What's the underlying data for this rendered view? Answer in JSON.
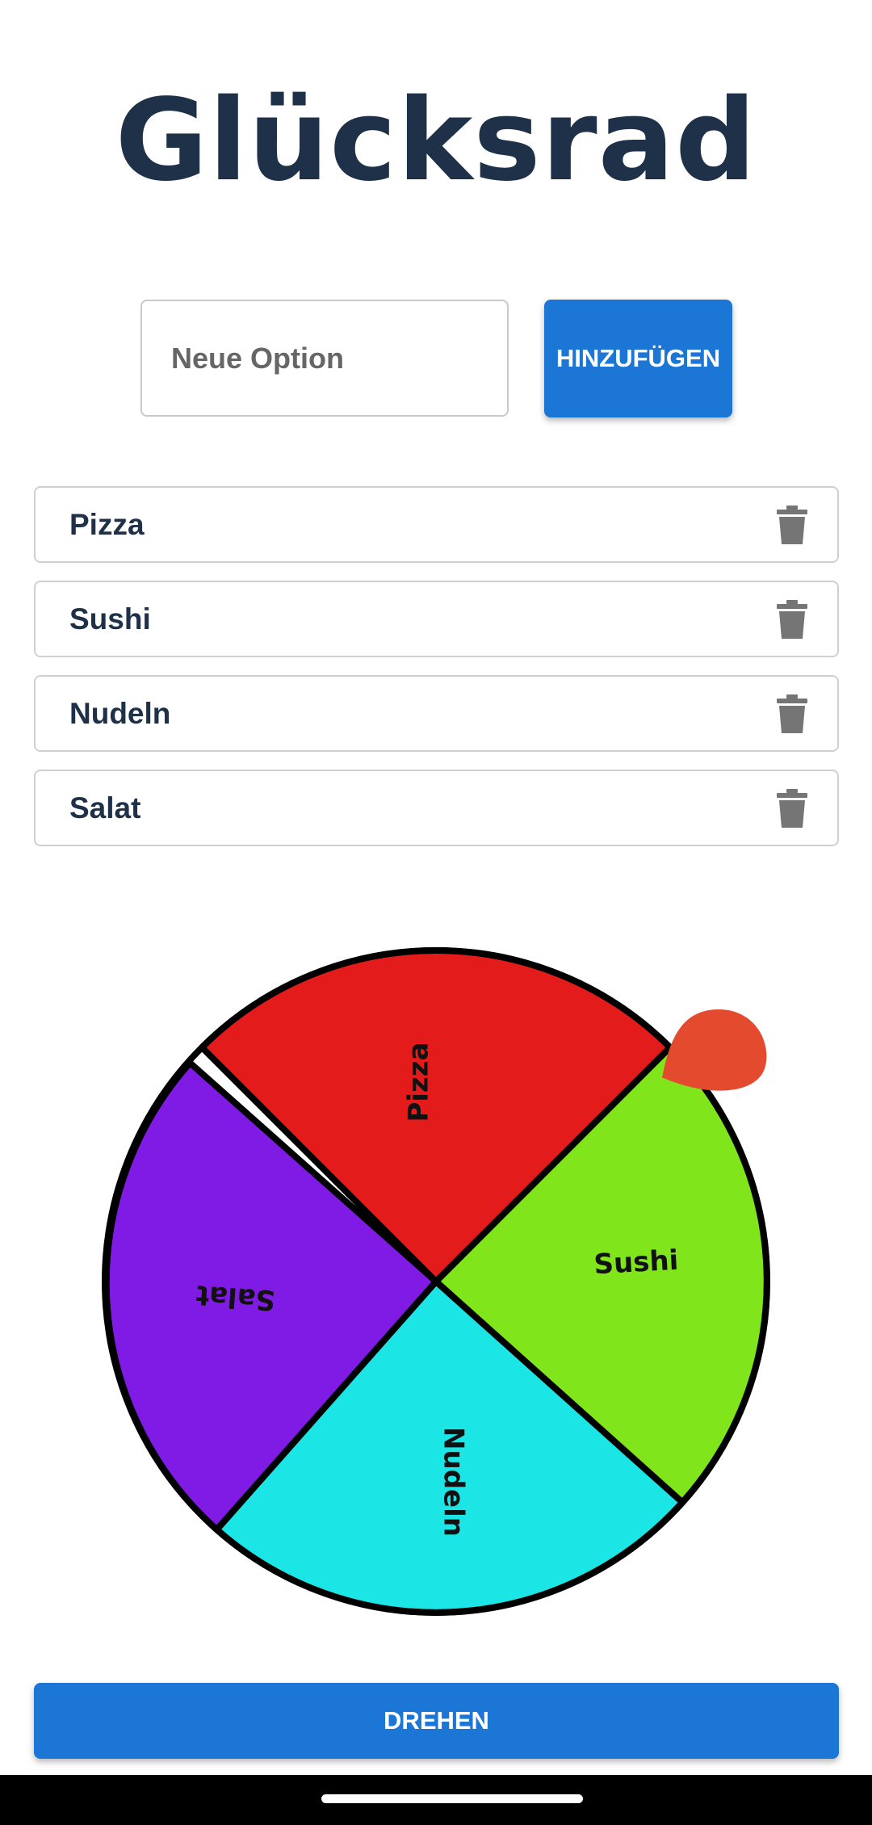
{
  "header": {
    "title": "Glücksrad"
  },
  "add_form": {
    "input_placeholder": "Neue Option",
    "input_value": "",
    "add_button_label": "HINZUFÜGEN"
  },
  "options": [
    {
      "label": "Pizza",
      "delete_icon": "trash-icon"
    },
    {
      "label": "Sushi",
      "delete_icon": "trash-icon"
    },
    {
      "label": "Nudeln",
      "delete_icon": "trash-icon"
    },
    {
      "label": "Salat",
      "delete_icon": "trash-icon"
    }
  ],
  "wheel": {
    "segments": [
      {
        "label": "Pizza",
        "color": "#e31b1b"
      },
      {
        "label": "Sushi",
        "color": "#80e51a"
      },
      {
        "label": "Nudeln",
        "color": "#1be5e5"
      },
      {
        "label": "Salat",
        "color": "#801be5"
      }
    ],
    "pointer_color": "#e44a2e",
    "pointer_icon": "pointer-pin-icon"
  },
  "spin_button_label": "DREHEN",
  "colors": {
    "title": "#1f3148",
    "primary": "#1c76d6",
    "delete_icon": "#757575"
  }
}
